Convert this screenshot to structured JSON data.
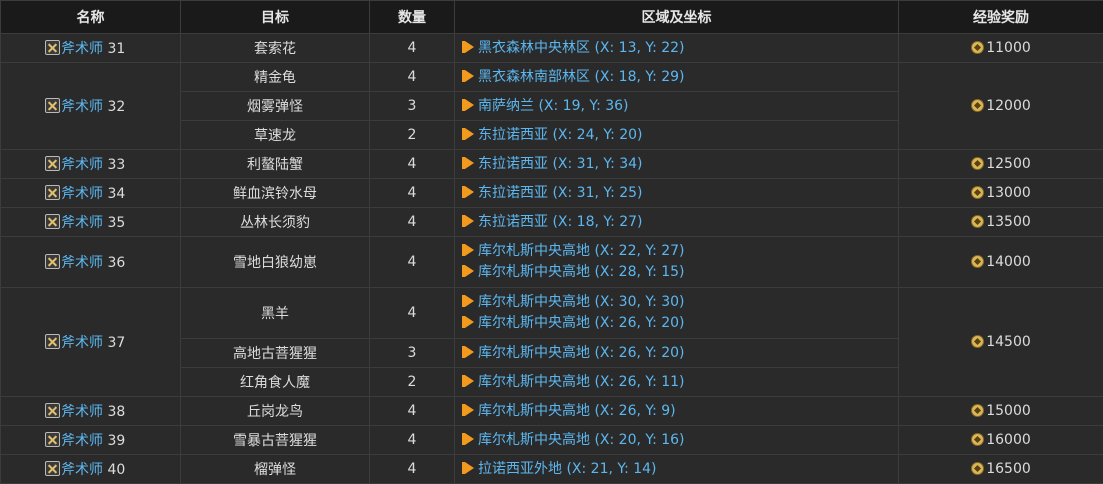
{
  "headers": [
    "名称",
    "目标",
    "数量",
    "区域及坐标",
    "经验奖励"
  ],
  "class_name": "斧术师",
  "groups": [
    {
      "level": "31",
      "exp": "11000",
      "rows": [
        {
          "target": "套索花",
          "count": "4",
          "zones": [
            "黑衣森林中央林区 (X: 13, Y: 22)"
          ]
        }
      ]
    },
    {
      "level": "32",
      "exp": "12000",
      "rows": [
        {
          "target": "精金龟",
          "count": "4",
          "zones": [
            "黑衣森林南部林区 (X: 18, Y: 29)"
          ]
        },
        {
          "target": "烟雾弹怪",
          "count": "3",
          "zones": [
            "南萨纳兰 (X: 19, Y: 36)"
          ]
        },
        {
          "target": "草速龙",
          "count": "2",
          "zones": [
            "东拉诺西亚 (X: 24, Y: 20)"
          ]
        }
      ]
    },
    {
      "level": "33",
      "exp": "12500",
      "rows": [
        {
          "target": "利螯陆蟹",
          "count": "4",
          "zones": [
            "东拉诺西亚 (X: 31, Y: 34)"
          ]
        }
      ]
    },
    {
      "level": "34",
      "exp": "13000",
      "rows": [
        {
          "target": "鲜血滨铃水母",
          "count": "4",
          "zones": [
            "东拉诺西亚 (X: 31, Y: 25)"
          ]
        }
      ]
    },
    {
      "level": "35",
      "exp": "13500",
      "rows": [
        {
          "target": "丛林长须豹",
          "count": "4",
          "zones": [
            "东拉诺西亚 (X: 18, Y: 27)"
          ]
        }
      ]
    },
    {
      "level": "36",
      "exp": "14000",
      "rows": [
        {
          "target": "雪地白狼幼崽",
          "count": "4",
          "zones": [
            "库尔札斯中央高地 (X: 22, Y: 27)",
            "库尔札斯中央高地 (X: 28, Y: 15)"
          ]
        }
      ]
    },
    {
      "level": "37",
      "exp": "14500",
      "rows": [
        {
          "target": "黑羊",
          "count": "4",
          "zones": [
            "库尔札斯中央高地 (X: 30, Y: 30)",
            "库尔札斯中央高地 (X: 26, Y: 20)"
          ]
        },
        {
          "target": "高地古菩猩猩",
          "count": "3",
          "zones": [
            "库尔札斯中央高地 (X: 26, Y: 20)"
          ]
        },
        {
          "target": "红角食人魔",
          "count": "2",
          "zones": [
            "库尔札斯中央高地 (X: 26, Y: 11)"
          ]
        }
      ]
    },
    {
      "level": "38",
      "exp": "15000",
      "rows": [
        {
          "target": "丘岗龙鸟",
          "count": "4",
          "zones": [
            "库尔札斯中央高地 (X: 26, Y: 9)"
          ]
        }
      ]
    },
    {
      "level": "39",
      "exp": "16000",
      "rows": [
        {
          "target": "雪暴古菩猩猩",
          "count": "4",
          "zones": [
            "库尔札斯中央高地 (X: 20, Y: 16)"
          ]
        }
      ]
    },
    {
      "level": "40",
      "exp": "16500",
      "rows": [
        {
          "target": "榴弹怪",
          "count": "4",
          "zones": [
            "拉诺西亚外地 (X: 21, Y: 14)"
          ]
        }
      ]
    }
  ]
}
